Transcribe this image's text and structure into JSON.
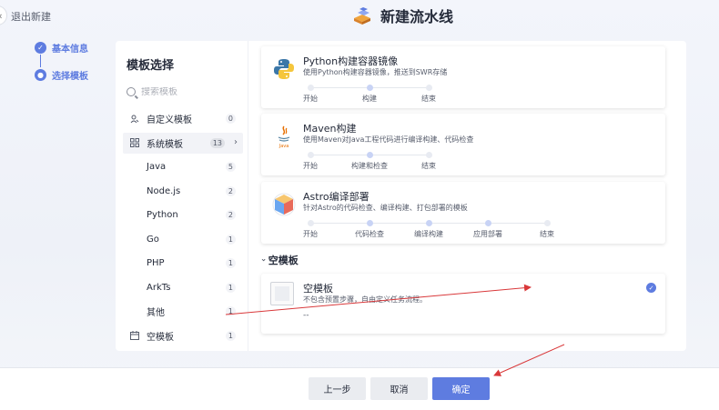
{
  "header": {
    "exit_label": "退出新建",
    "title": "新建流水线"
  },
  "steps": [
    {
      "label": "基本信息",
      "state": "done"
    },
    {
      "label": "选择模板",
      "state": "active"
    }
  ],
  "sidebar": {
    "title": "模板选择",
    "search_placeholder": "搜索模板",
    "items": [
      {
        "label": "自定义模板",
        "count": "0"
      },
      {
        "label": "系统模板",
        "count": "13"
      },
      {
        "label": "Java",
        "count": "5"
      },
      {
        "label": "Node.js",
        "count": "2"
      },
      {
        "label": "Python",
        "count": "2"
      },
      {
        "label": "Go",
        "count": "1"
      },
      {
        "label": "PHP",
        "count": "1"
      },
      {
        "label": "ArkTs",
        "count": "1"
      },
      {
        "label": "其他",
        "count": "1"
      },
      {
        "label": "空模板",
        "count": "1"
      }
    ]
  },
  "templates": [
    {
      "name": "Python构建容器镜像",
      "description": "使用Python构建容器镜像，推送到SWR存储",
      "stages": [
        "开始",
        "构建",
        "结束"
      ]
    },
    {
      "name": "Maven构建",
      "description": "使用Maven对Java工程代码进行编译构建、代码检查",
      "stages": [
        "开始",
        "构建和检查",
        "结束"
      ]
    },
    {
      "name": "Astro编译部署",
      "description": "针对Astro的代码检查、编译构建、打包部署的模板",
      "stages": [
        "开始",
        "代码检查",
        "编译构建",
        "应用部署",
        "结束"
      ]
    }
  ],
  "blank_group": {
    "title": "空模板",
    "card": {
      "name": "空模板",
      "description": "不包含预置步骤，自由定义任务流程。",
      "extra": "--",
      "selected": true
    }
  },
  "footer": {
    "prev_label": "上一步",
    "cancel_label": "取消",
    "ok_label": "确定"
  },
  "colors": {
    "accent": "#5e7ce0",
    "annotation_arrow": "#d9383a"
  }
}
